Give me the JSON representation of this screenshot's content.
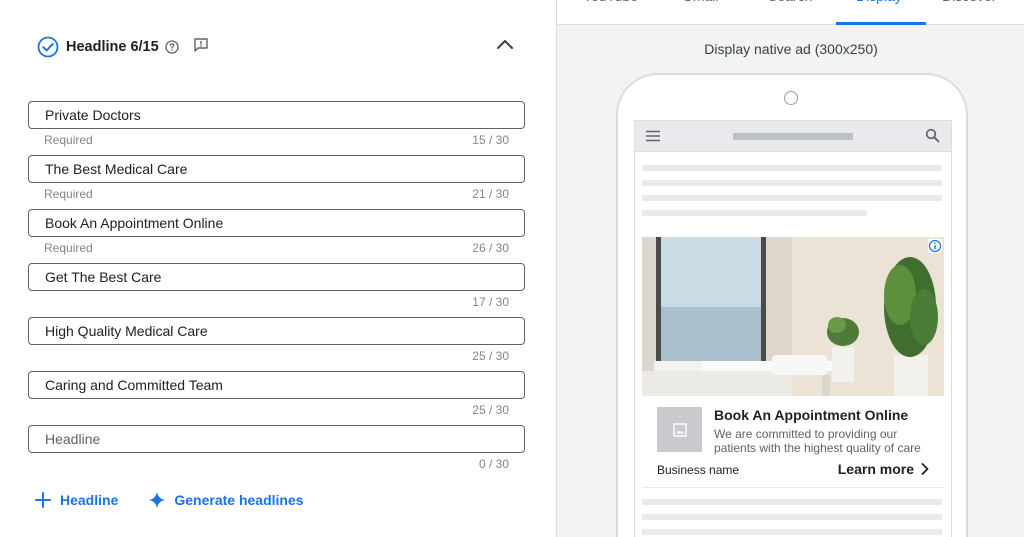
{
  "headline_section": {
    "title": "Headline 6/15",
    "items": [
      {
        "value": "Private Doctors",
        "required": "Required",
        "count": "15 / 30"
      },
      {
        "value": "The Best Medical Care",
        "required": "Required",
        "count": "21 / 30"
      },
      {
        "value": "Book An Appointment Online",
        "required": "Required",
        "count": "26 / 30"
      },
      {
        "value": "Get The Best Care",
        "required": "",
        "count": "17 / 30"
      },
      {
        "value": "High Quality Medical Care",
        "required": "",
        "count": "25 / 30"
      },
      {
        "value": "Caring and Committed Team",
        "required": "",
        "count": "25 / 30"
      },
      {
        "value": "",
        "placeholder": "Headline",
        "required": "",
        "count": "0 / 30"
      }
    ],
    "add_label": "Headline",
    "generate_label": "Generate headlines"
  },
  "preview": {
    "tabs": [
      "YouTube",
      "Gmail",
      "Search",
      "Display",
      "Discover"
    ],
    "active_tab": "Display",
    "label": "Display native ad (300x250)",
    "ad": {
      "title": "Book An Appointment Online",
      "description": "We are committed to providing our patients with the highest quality of care",
      "business_name": "Business name",
      "cta": "Learn more"
    }
  },
  "colors": {
    "accent": "#1a73e8",
    "check": "#1a73e8",
    "border": "#5f6368",
    "panel_bg": "#f1f3f4",
    "skeleton": "#e8eaed"
  },
  "icons": {
    "section_status": "check-circle-icon",
    "help": "help-circle-icon",
    "feedback": "feedback-icon",
    "collapse": "chevron-up-icon",
    "add": "plus-icon",
    "generate": "sparkle-icon",
    "menu": "hamburger-menu-icon",
    "search": "search-icon",
    "info": "info-icon",
    "image_placeholder": "image-icon",
    "cta": "chevron-right-icon"
  }
}
